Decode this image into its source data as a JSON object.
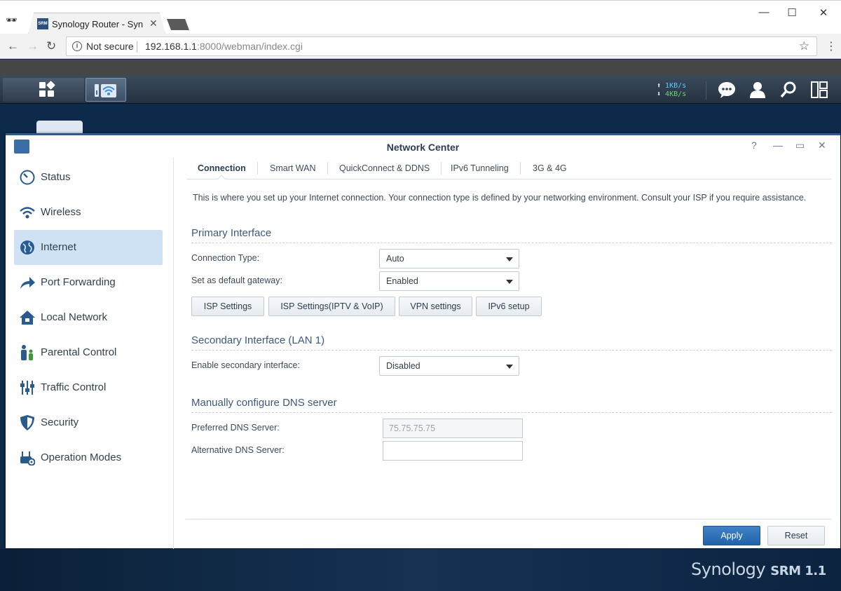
{
  "browser": {
    "tab_title": "Synology Router - Synology",
    "tab_favicon": "SRM",
    "security_label": "Not secure",
    "url_host": "192.168.1.1",
    "url_rest": ":8000/webman/index.cgi"
  },
  "taskbar": {
    "upload_speed": "1KB/s",
    "download_speed": "4KB/s"
  },
  "window": {
    "title": "Network Center"
  },
  "sidebar": {
    "items": [
      {
        "label": "Status",
        "icon": "gauge-icon"
      },
      {
        "label": "Wireless",
        "icon": "wifi-icon"
      },
      {
        "label": "Internet",
        "icon": "globe-icon",
        "active": true
      },
      {
        "label": "Port Forwarding",
        "icon": "forward-arrow-icon"
      },
      {
        "label": "Local Network",
        "icon": "house-icon"
      },
      {
        "label": "Parental Control",
        "icon": "family-icon"
      },
      {
        "label": "Traffic Control",
        "icon": "sliders-icon"
      },
      {
        "label": "Security",
        "icon": "shield-icon"
      },
      {
        "label": "Operation Modes",
        "icon": "router-gear-icon"
      }
    ]
  },
  "tabs": [
    "Connection",
    "Smart WAN",
    "QuickConnect & DDNS",
    "IPv6 Tunneling",
    "3G & 4G"
  ],
  "main": {
    "description": "This is where you set up your Internet connection. Your connection type is defined by your networking environment. Consult your ISP if you require assistance.",
    "primary": {
      "heading": "Primary Interface",
      "connection_type_label": "Connection Type:",
      "connection_type_value": "Auto",
      "default_gateway_label": "Set as default gateway:",
      "default_gateway_value": "Enabled",
      "buttons": [
        "ISP Settings",
        "ISP Settings(IPTV & VoIP)",
        "VPN settings",
        "IPv6 setup"
      ]
    },
    "secondary": {
      "heading": "Secondary Interface (LAN 1)",
      "enable_label": "Enable secondary interface:",
      "enable_value": "Disabled"
    },
    "dns": {
      "heading": "Manually configure DNS server",
      "preferred_label": "Preferred DNS Server:",
      "preferred_placeholder": "75.75.75.75",
      "alternative_label": "Alternative DNS Server:",
      "alternative_value": ""
    }
  },
  "footer": {
    "apply_label": "Apply",
    "reset_label": "Reset"
  },
  "branding": {
    "name": "Synology",
    "product": "SRM 1.1"
  },
  "colors": {
    "accent": "#2163a8",
    "active_item": "#cfe2f4",
    "window_border": "#2c5a8c"
  }
}
